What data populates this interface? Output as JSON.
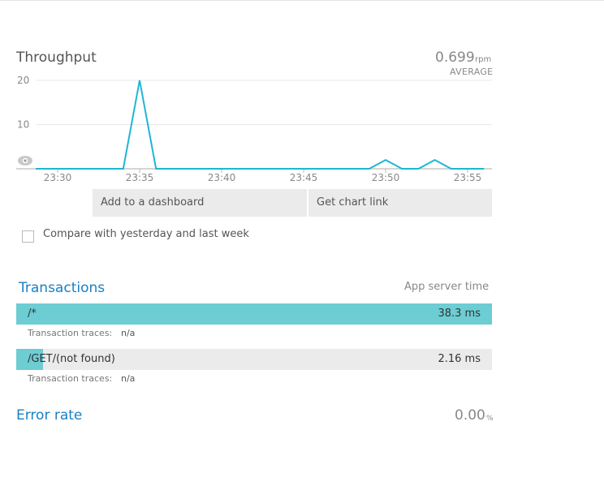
{
  "throughput": {
    "title": "Throughput",
    "average_value": "0.699",
    "average_unit": "rpm",
    "average_label": "AVERAGE"
  },
  "chart_data": {
    "type": "line",
    "title": "Throughput",
    "ylabel": "",
    "xlabel": "",
    "ylim": [
      0,
      20
    ],
    "yticks": [
      "20",
      "10"
    ],
    "xticks": [
      "23:30",
      "23:35",
      "23:40",
      "23:45",
      "23:50",
      "23:55"
    ],
    "grid": true,
    "series": [
      {
        "color": "#1fb6d4",
        "x": [
          "23:28",
          "23:29",
          "23:30",
          "23:31",
          "23:32",
          "23:33",
          "23:34",
          "23:35",
          "23:36",
          "23:37",
          "23:38",
          "23:39",
          "23:40",
          "23:41",
          "23:42",
          "23:43",
          "23:44",
          "23:45",
          "23:46",
          "23:47",
          "23:48",
          "23:49",
          "23:50",
          "23:51",
          "23:52",
          "23:53",
          "23:54",
          "23:55",
          "23:56"
        ],
        "values": [
          0,
          0,
          0,
          0,
          0,
          0,
          0,
          20,
          0,
          0,
          0,
          0,
          0,
          0,
          0,
          0,
          0,
          0,
          0,
          0,
          0,
          0,
          2,
          0,
          0,
          2,
          0,
          0,
          0
        ]
      }
    ]
  },
  "buttons": {
    "add_dashboard": "Add to a dashboard",
    "chart_link": "Get chart link"
  },
  "compare": {
    "label": "Compare with yesterday and last week",
    "checked": false
  },
  "transactions": {
    "heading": "Transactions",
    "subheading": "App server time",
    "trace_label": "Transaction traces:",
    "rows": [
      {
        "name": "/*",
        "time": "38.3 ms",
        "traces": "n/a",
        "fraction": 1.0
      },
      {
        "name": "/GET/(not found)",
        "time": "2.16 ms",
        "traces": "n/a",
        "fraction": 0.056
      }
    ]
  },
  "error_rate": {
    "heading": "Error rate",
    "value": "0.00",
    "unit": "%"
  },
  "colors": {
    "line": "#1fb6d4",
    "bar_fill": "#6ccdd3",
    "link_blue": "#1a80c4"
  }
}
